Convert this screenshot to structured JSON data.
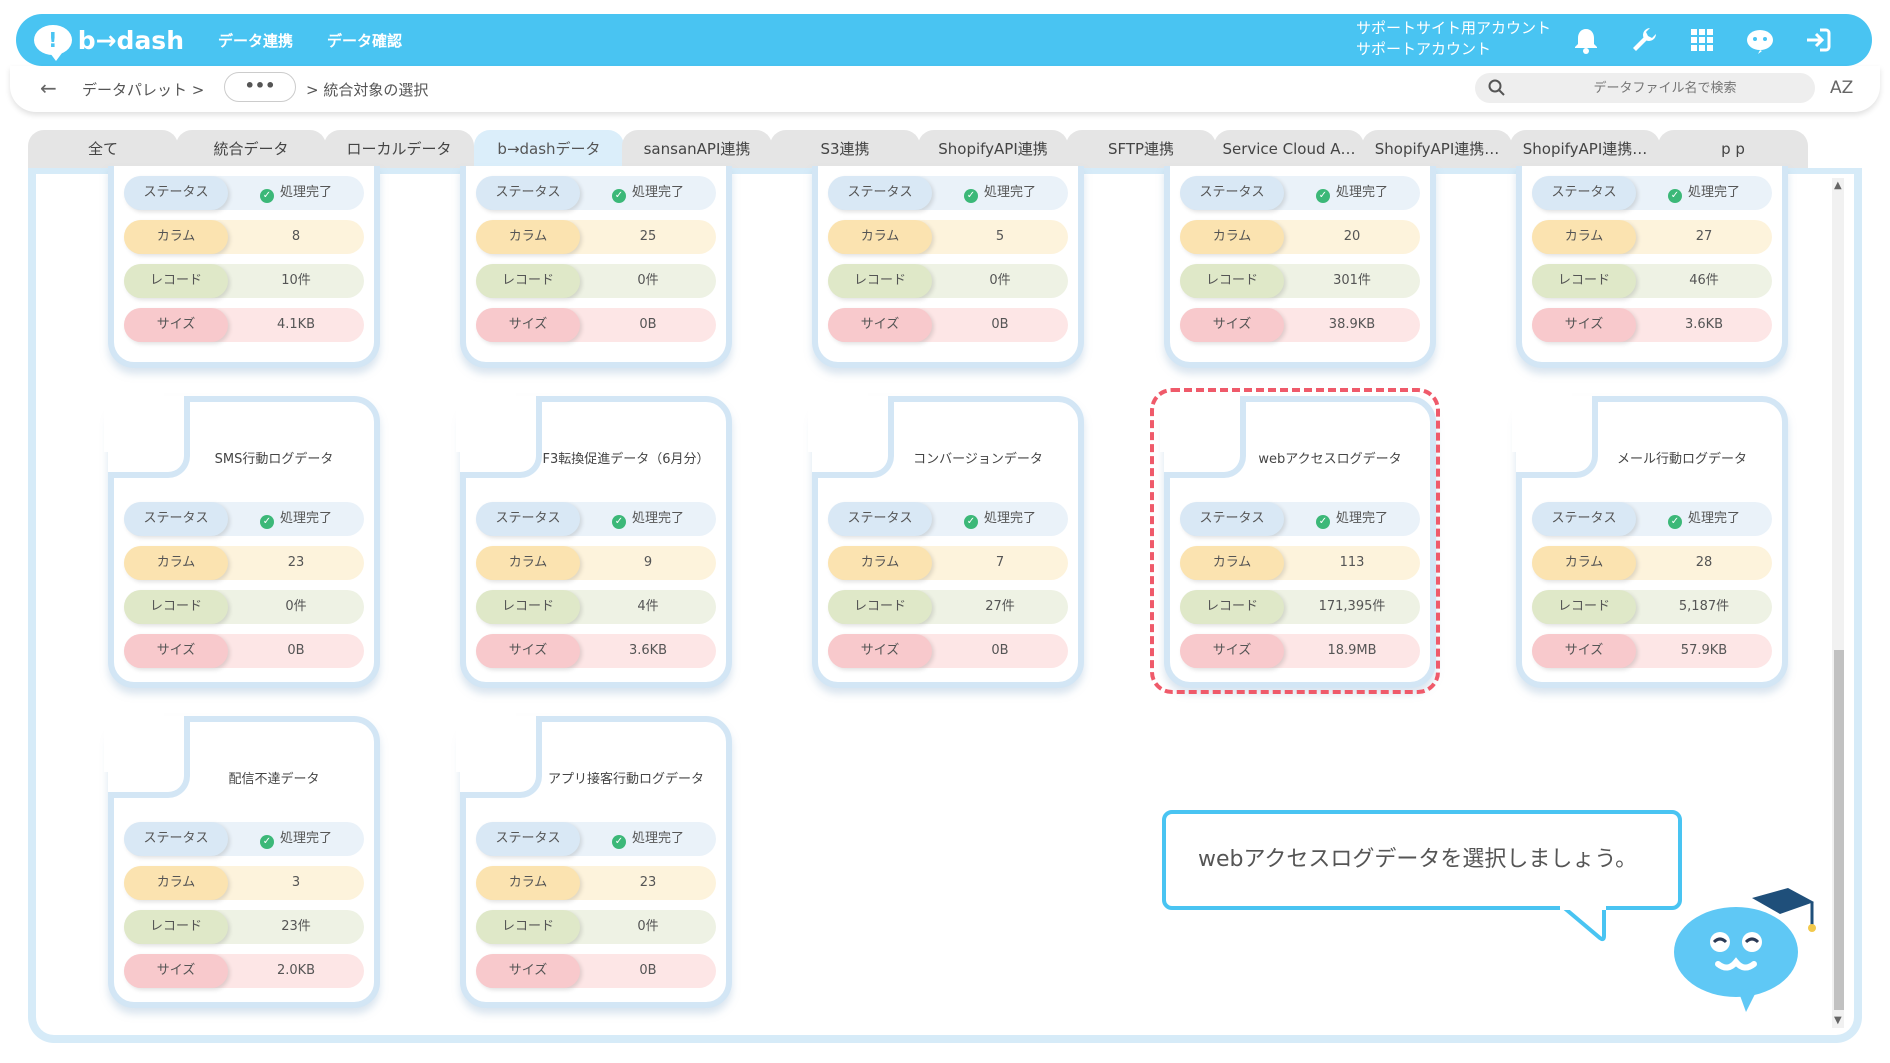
{
  "header": {
    "logo_text": "b→dash",
    "nav": [
      "データ連携",
      "データ確認"
    ],
    "account_line1": "サポートサイト用アカウント",
    "account_line2": "サポートアカウント",
    "icons": [
      "bell-icon",
      "wrench-icon",
      "grid-icon",
      "mascot-icon",
      "logout-icon"
    ]
  },
  "breadcrumb": {
    "back": "←",
    "item1": "データパレット >",
    "more": "•••",
    "current": "> 統合対象の選択"
  },
  "search": {
    "placeholder": "データファイル名で検索"
  },
  "sort_label": "AZ",
  "tabs": [
    "全て",
    "統合データ",
    "ローカルデータ",
    "b→dashデータ",
    "sansanAPI連携",
    "S3連携",
    "ShopifyAPI連携",
    "SFTP連携",
    "Service Cloud A…",
    "ShopifyAPI連携…",
    "ShopifyAPI連携…",
    "p p"
  ],
  "active_tab": "b→dashデータ",
  "labels": {
    "status": "ステータス",
    "column": "カラム",
    "record": "レコード",
    "size": "サイズ"
  },
  "cards": [
    {
      "title": "",
      "status": "処理完了",
      "columns": "8",
      "records": "10件",
      "size": "4.1KB"
    },
    {
      "title": "",
      "status": "処理完了",
      "columns": "25",
      "records": "0件",
      "size": "0B"
    },
    {
      "title": "",
      "status": "処理完了",
      "columns": "5",
      "records": "0件",
      "size": "0B"
    },
    {
      "title": "",
      "status": "処理完了",
      "columns": "20",
      "records": "301件",
      "size": "38.9KB"
    },
    {
      "title": "",
      "status": "処理完了",
      "columns": "27",
      "records": "46件",
      "size": "3.6KB"
    },
    {
      "title": "SMS行動ログデータ",
      "status": "処理完了",
      "columns": "23",
      "records": "0件",
      "size": "0B"
    },
    {
      "title": "F3転換促進データ（6月分）",
      "status": "処理完了",
      "columns": "9",
      "records": "4件",
      "size": "3.6KB"
    },
    {
      "title": "コンバージョンデータ",
      "status": "処理完了",
      "columns": "7",
      "records": "27件",
      "size": "0B"
    },
    {
      "title": "webアクセスログデータ",
      "status": "処理完了",
      "columns": "113",
      "records": "171,395件",
      "size": "18.9MB"
    },
    {
      "title": "メール行動ログデータ",
      "status": "処理完了",
      "columns": "28",
      "records": "5,187件",
      "size": "57.9KB"
    },
    {
      "title": "配信不達データ",
      "status": "処理完了",
      "columns": "3",
      "records": "23件",
      "size": "2.0KB"
    },
    {
      "title": "アプリ接客行動ログデータ",
      "status": "処理完了",
      "columns": "23",
      "records": "0件",
      "size": "0B"
    }
  ],
  "tooltip": "webアクセスログデータを選択しましょう。",
  "colors": {
    "accent": "#49c4f2",
    "highlight": "#ef5a6a",
    "success": "#3cb878"
  }
}
